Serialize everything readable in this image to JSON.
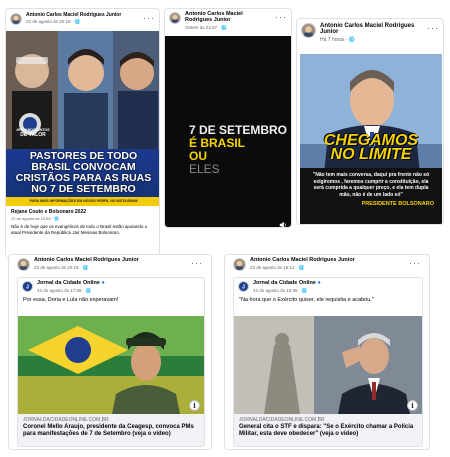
{
  "post1": {
    "author": "Antonio Carlos Maciel Rodrigues Junior",
    "time": "22 de agosto às 20:18 · ",
    "shared_name": "Rejane Couto e Bolsonaro 2022",
    "shared_time": "22 de agosto às 15:59 · ",
    "shared_text": "Não é de hoje que os evangélicos de todo o Brasil estão apoiando o atual Presidente da República Jair Messias Bolsonaro.",
    "image": {
      "badge_line1": "#ESTAMOSJUNTOS",
      "badge_line2": "DE VALOR",
      "headline": "PASTORES DE TODO BRASIL CONVOCAM CRISTÃOS PARA AS RUAS NO 7 DE SETEMBRO",
      "footer": "PARA MAIS INFORMAÇÕES EM NOSSO PERFIL NO INSTAGRAM"
    }
  },
  "post2": {
    "author": "Antonio Carlos Maciel Rodrigues Junior",
    "time": "Ontem às 23:37 · ",
    "video": {
      "line1": "7 DE SETEMBRO",
      "line2": "É BRASIL",
      "line3": "OU",
      "line4": "ELES"
    }
  },
  "post3": {
    "author": "Antonio Carlos Maciel Rodrigues Junior",
    "time": "Há 7 horas · ",
    "image": {
      "headline_1": "CHEGAMOS",
      "headline_2": "NO LIMITE",
      "quote": "\"Não tem mais conversa, daqui pra frente não só exigiremos , faremos cumprir a constituição, ela será cumprida a qualquer preço, e ela tem dupla mão, não é de um lado só\"",
      "caption": "PRESIDENTE BOLSONARO"
    }
  },
  "post4": {
    "author": "Antonio Carlos Maciel Rodrigues Junior",
    "time": "22 de agosto às 20:19 · ",
    "shared_name": "Jornal da Cidade Online",
    "shared_time": "22 de agosto às 17:58 · ",
    "shared_text": "Por essa, Doria e Lula não esperavam!",
    "link_domain": "JORNALDACIDADEONLINE.COM.BR",
    "link_title": "Coronel Mello Araujo, presidente da Ceagesp, convoca PMs para manifestações de 7 de Setembro (veja o vídeo)"
  },
  "post5": {
    "author": "Antonio Carlos Maciel Rodrigues Junior",
    "time": "22 de agosto às 16:12 · ",
    "shared_name": "Jornal da Cidade Online",
    "shared_time": "22 de agosto às 15:36 · ",
    "shared_text": "\"Na hora que o Exército quiser, ele requisita e acabou.\"",
    "link_domain": "JORNALDACIDADEONLINE.COM.BR",
    "link_title": "General cita o STF e dispara: \"Se o Exército chamar a Polícia Militar, esta deve obedecer\" (veja o vídeo)"
  },
  "icons": {
    "more": "more-dots-icon",
    "globe": "globe-icon",
    "info": "info-icon",
    "volume": "volume-icon"
  },
  "colors": {
    "brand_blue": "#1877f2",
    "headline_yellow": "#f5d400",
    "video_bg": "#0b0b0b"
  }
}
